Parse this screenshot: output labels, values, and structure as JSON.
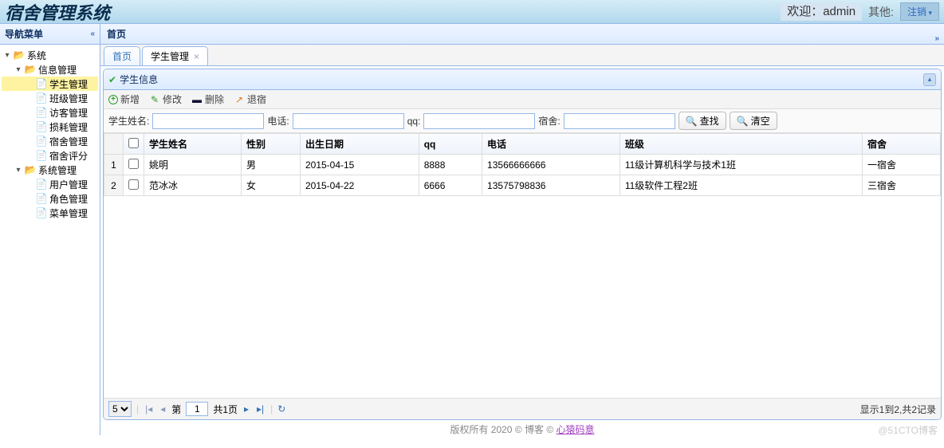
{
  "header": {
    "title": "宿舍管理系统",
    "welcome": "欢迎：admin",
    "other": "其他:",
    "logout": "注销"
  },
  "nav": {
    "title": "导航菜单",
    "items": [
      {
        "label": "系统",
        "type": "folder",
        "open": true,
        "ind": 0
      },
      {
        "label": "信息管理",
        "type": "folder",
        "open": true,
        "ind": 1
      },
      {
        "label": "学生管理",
        "type": "page",
        "sel": true,
        "ind": 2
      },
      {
        "label": "班级管理",
        "type": "page",
        "ind": 2
      },
      {
        "label": "访客管理",
        "type": "page",
        "ind": 2
      },
      {
        "label": "损耗管理",
        "type": "page",
        "ind": 2
      },
      {
        "label": "宿舍管理",
        "type": "page",
        "ind": 2
      },
      {
        "label": "宿舍评分",
        "type": "page",
        "ind": 2
      },
      {
        "label": "系统管理",
        "type": "folder",
        "open": true,
        "ind": 1
      },
      {
        "label": "用户管理",
        "type": "page",
        "ind": 2
      },
      {
        "label": "角色管理",
        "type": "page",
        "ind": 2
      },
      {
        "label": "菜单管理",
        "type": "page",
        "ind": 2
      }
    ]
  },
  "breadcrumb": "首页",
  "tabs": [
    {
      "label": "首页",
      "active": false,
      "closable": false
    },
    {
      "label": "学生管理",
      "active": true,
      "closable": true
    }
  ],
  "panel": {
    "title": "学生信息",
    "toolbar": {
      "add": "新增",
      "edit": "修改",
      "del": "删除",
      "out": "退宿"
    },
    "search": {
      "name_lbl": "学生姓名:",
      "tel_lbl": "电话:",
      "qq_lbl": "qq:",
      "dorm_lbl": "宿舍:",
      "find": "查找",
      "clear": "清空"
    },
    "columns": [
      "学生姓名",
      "性别",
      "出生日期",
      "qq",
      "电话",
      "班级",
      "宿舍"
    ],
    "rows": [
      {
        "name": "姚明",
        "sex": "男",
        "dob": "2015-04-15",
        "qq": "8888",
        "tel": "13566666666",
        "cls": "11级计算机科学与技术1班",
        "dorm": "一宿舍"
      },
      {
        "name": "范冰冰",
        "sex": "女",
        "dob": "2015-04-22",
        "qq": "6666",
        "tel": "13575798836",
        "cls": "11级软件工程2班",
        "dorm": "三宿舍"
      }
    ]
  },
  "pager": {
    "size": "5",
    "page_lbl_pre": "第",
    "page": "1",
    "page_lbl_post": "共1页",
    "info": "显示1到2,共2记录"
  },
  "footer": {
    "text": "版权所有 2020 © 博客 © ",
    "link": "心猿码意"
  },
  "watermark": "@51CTO博客"
}
